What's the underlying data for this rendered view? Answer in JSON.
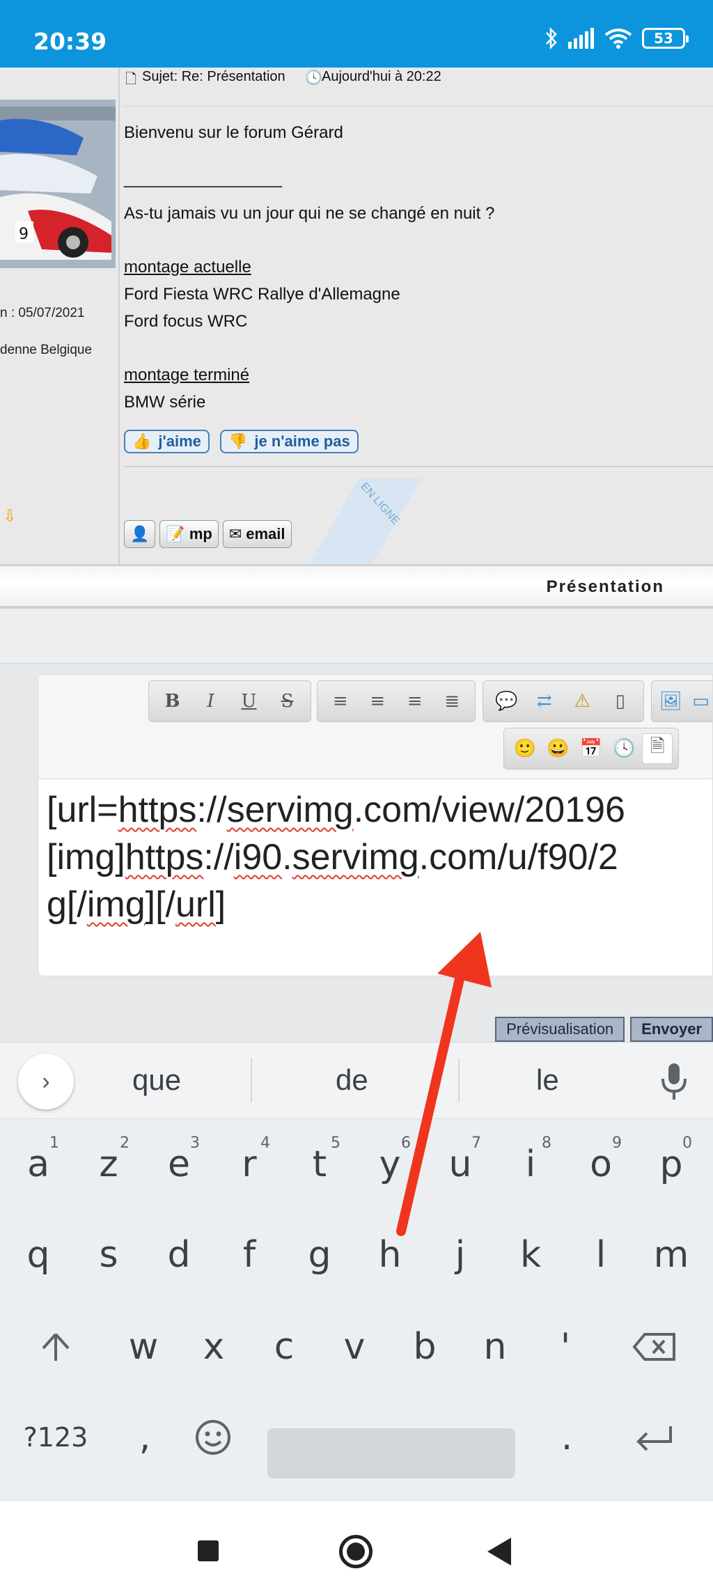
{
  "status_bar": {
    "time": "20:39",
    "battery": "53",
    "icons": [
      "bluetooth-icon",
      "signal-icon",
      "wifi-icon",
      "battery-icon"
    ]
  },
  "post": {
    "subject_label": "Sujet: Re: Présentation",
    "date_label": "Aujourd'hui à 20:22",
    "left_meta": {
      "joined": "n : 05/07/2021",
      "location": "denne Belgique"
    },
    "body": {
      "line1": "Bienvenu sur le forum Gérard",
      "signature_sep": "_________________",
      "quote": "As-tu jamais vu un jour qui ne se changé en nuit ?",
      "heading1": "montage actuelle",
      "item1": "Ford Fiesta WRC Rallye d'Allemagne",
      "item2": "Ford focus WRC",
      "heading2": "montage terminé",
      "item3": "BMW série"
    },
    "like_label": "j'aime",
    "dislike_label": "je n'aime pas",
    "online_label": "EN LIGNE",
    "profile_buttons": {
      "mp": "mp",
      "email": "email"
    }
  },
  "section": {
    "title": "Présentation"
  },
  "editor": {
    "line1_a": "[url=",
    "line1_b": "https",
    "line1_c": "://",
    "line1_d": "servimg",
    "line1_e": ".com/view/20196",
    "line2_a": "[img]",
    "line2_b": "https",
    "line2_c": "://",
    "line2_d": "i90",
    "line2_e": ".",
    "line2_f": "servimg",
    "line2_g": ".com/u/f90/2",
    "line3_a": "g[/",
    "line3_b": "img",
    "line3_c": "][/",
    "line3_d": "url",
    "line3_e": "]",
    "toolbar": {
      "format_buttons": [
        "B",
        "I",
        "U",
        "S"
      ]
    }
  },
  "submit": {
    "preview": "Prévisualisation",
    "send": "Envoyer"
  },
  "keyboard": {
    "suggestions": [
      "que",
      "de",
      "le"
    ],
    "row1": [
      {
        "k": "a",
        "n": "1"
      },
      {
        "k": "z",
        "n": "2"
      },
      {
        "k": "e",
        "n": "3"
      },
      {
        "k": "r",
        "n": "4"
      },
      {
        "k": "t",
        "n": "5"
      },
      {
        "k": "y",
        "n": "6"
      },
      {
        "k": "u",
        "n": "7"
      },
      {
        "k": "i",
        "n": "8"
      },
      {
        "k": "o",
        "n": "9"
      },
      {
        "k": "p",
        "n": "0"
      }
    ],
    "row2": [
      "q",
      "s",
      "d",
      "f",
      "g",
      "h",
      "j",
      "k",
      "l",
      "m"
    ],
    "row3": [
      "w",
      "x",
      "c",
      "v",
      "b",
      "n",
      "'"
    ],
    "symbols": "?123",
    "comma": ",",
    "period": "."
  },
  "colors": {
    "status_bar": "#0c95dd",
    "annotation_arrow": "#f0351f",
    "link_blue": "#1d5fa0"
  }
}
